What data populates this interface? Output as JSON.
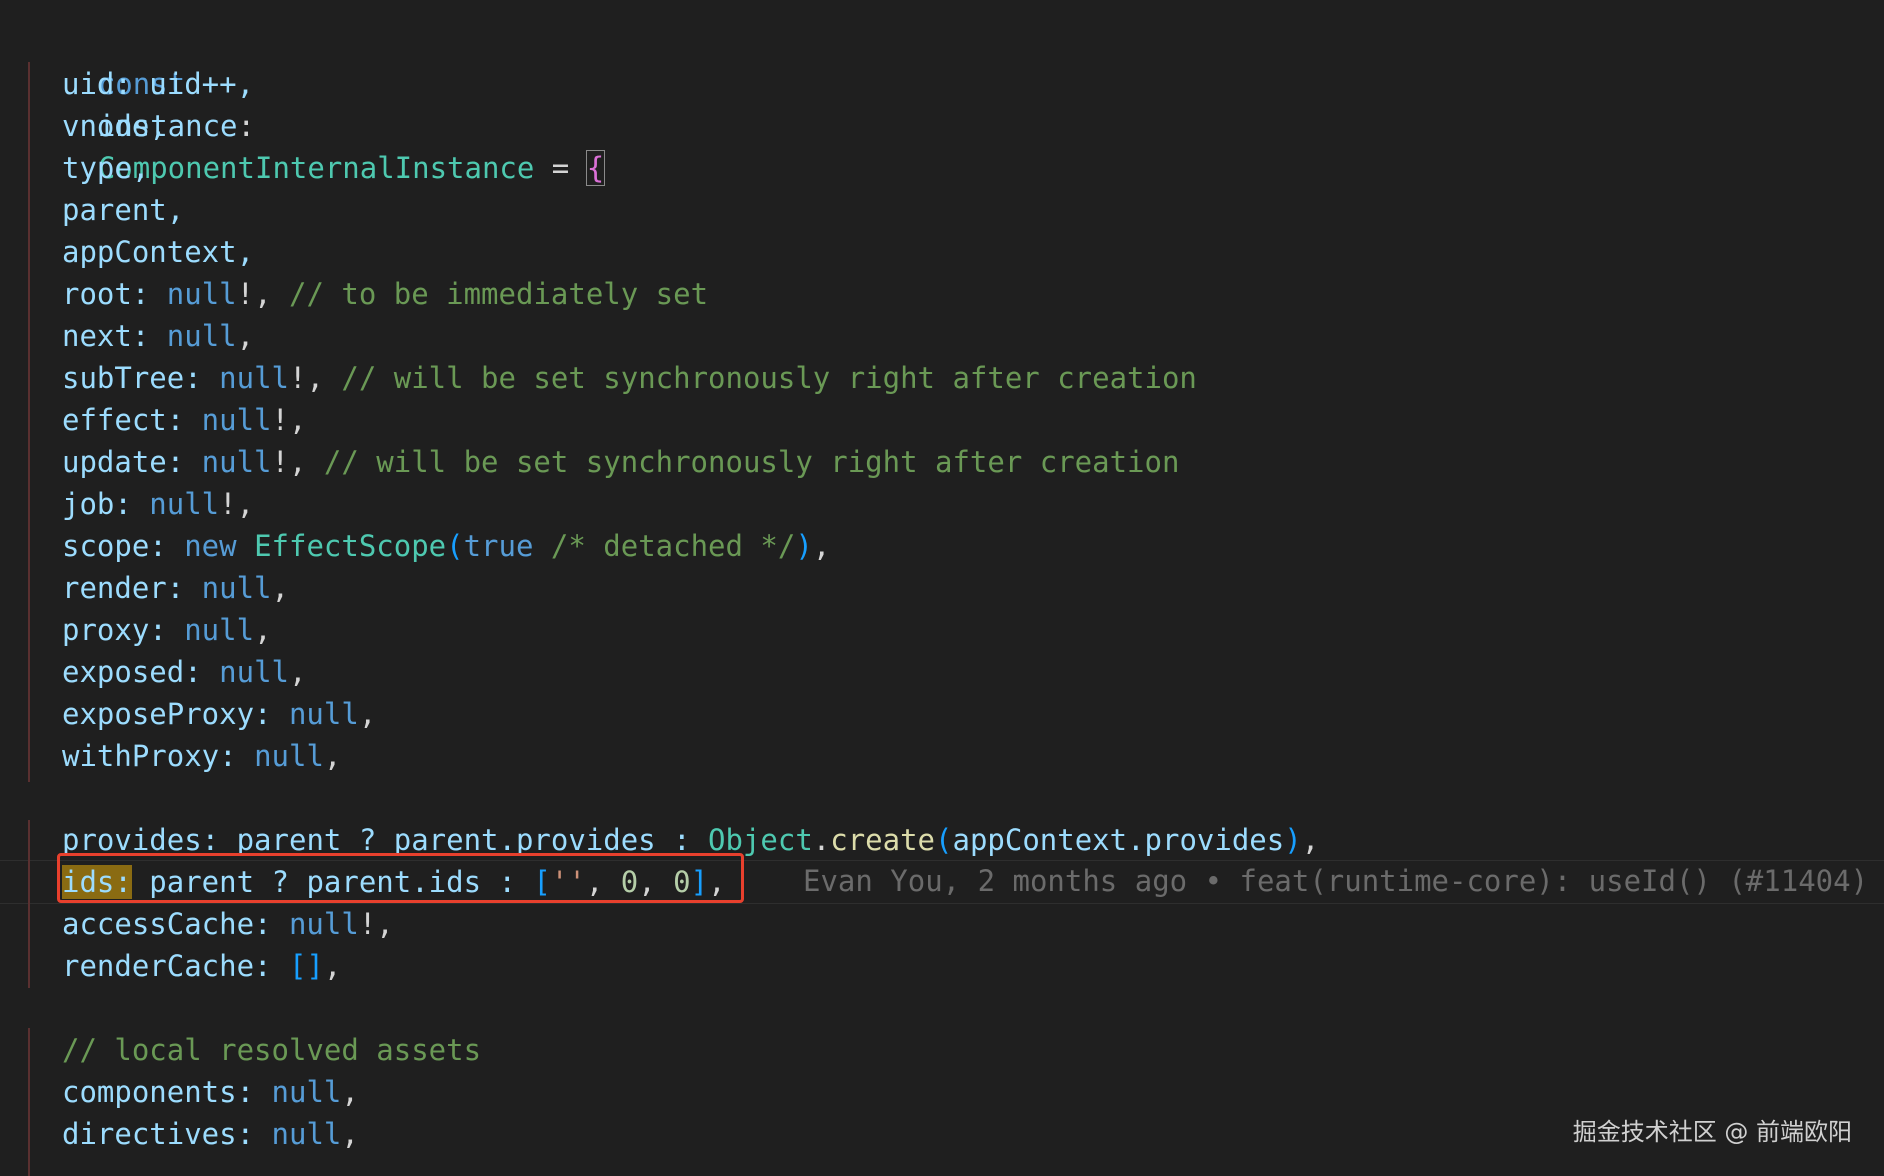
{
  "editor": {
    "line1": {
      "kw": "const",
      "var": "instance",
      "colon": ":",
      "type": "ComponentInternalInstance",
      "eq": " = ",
      "brace": "{"
    },
    "uid": {
      "key": "uid:",
      "val": " uid++,"
    },
    "vnode": "vnode,",
    "type_line": "type,",
    "parent": "parent,",
    "appContext": "appContext,",
    "root": {
      "key": "root:",
      "null": " null",
      "tail": "!,",
      "comment": " // to be immediately set"
    },
    "next": {
      "key": "next:",
      "null": " null",
      "tail": ","
    },
    "subTree": {
      "key": "subTree:",
      "null": " null",
      "tail": "!,",
      "comment": " // will be set synchronously right after creation"
    },
    "effect": {
      "key": "effect:",
      "null": " null",
      "tail": "!,"
    },
    "update": {
      "key": "update:",
      "null": " null",
      "tail": "!,",
      "comment": " // will be set synchronously right after creation"
    },
    "job": {
      "key": "job:",
      "null": " null",
      "tail": "!,"
    },
    "scope": {
      "key": "scope:",
      "new": " new",
      "cls": " EffectScope",
      "open": "(",
      "true": "true",
      "comment": " /* detached */",
      "close": ")",
      "tail": ","
    },
    "render": {
      "key": "render:",
      "null": " null",
      "tail": ","
    },
    "proxy": {
      "key": "proxy:",
      "null": " null",
      "tail": ","
    },
    "exposed": {
      "key": "exposed:",
      "null": " null",
      "tail": ","
    },
    "exposeProxy": {
      "key": "exposeProxy:",
      "null": " null",
      "tail": ","
    },
    "withProxy": {
      "key": "withProxy:",
      "null": " null",
      "tail": ","
    },
    "provides": {
      "key": "provides:",
      "p1": " parent ? parent.provides : ",
      "obj": "Object",
      "dot": ".",
      "fn": "create",
      "open": "(",
      "arg": "appContext.provides",
      "close": ")",
      "tail": ","
    },
    "ids": {
      "key": "ids:",
      "p1": " parent ? parent.ids : ",
      "open": "[",
      "str": "''",
      "c1": ", ",
      "n1": "0",
      "c2": ", ",
      "n2": "0",
      "close": "]",
      "tail": ","
    },
    "accessCache": {
      "key": "accessCache:",
      "null": " null",
      "tail": "!,"
    },
    "renderCache": {
      "key": "renderCache:",
      "arr": " []",
      "tail": ","
    },
    "assets_comment": "// local resolved assets",
    "components": {
      "key": "components:",
      "null": " null",
      "tail": ","
    },
    "directives": {
      "key": "directives:",
      "null": " null",
      "tail": ","
    }
  },
  "blame": "Evan You, 2 months ago • feat(runtime-core): useId() (#11404) …",
  "watermark": "掘金技术社区 @ 前端欧阳",
  "colors": {
    "highlight_box": "#e8402d",
    "background": "#1f1f1f"
  }
}
